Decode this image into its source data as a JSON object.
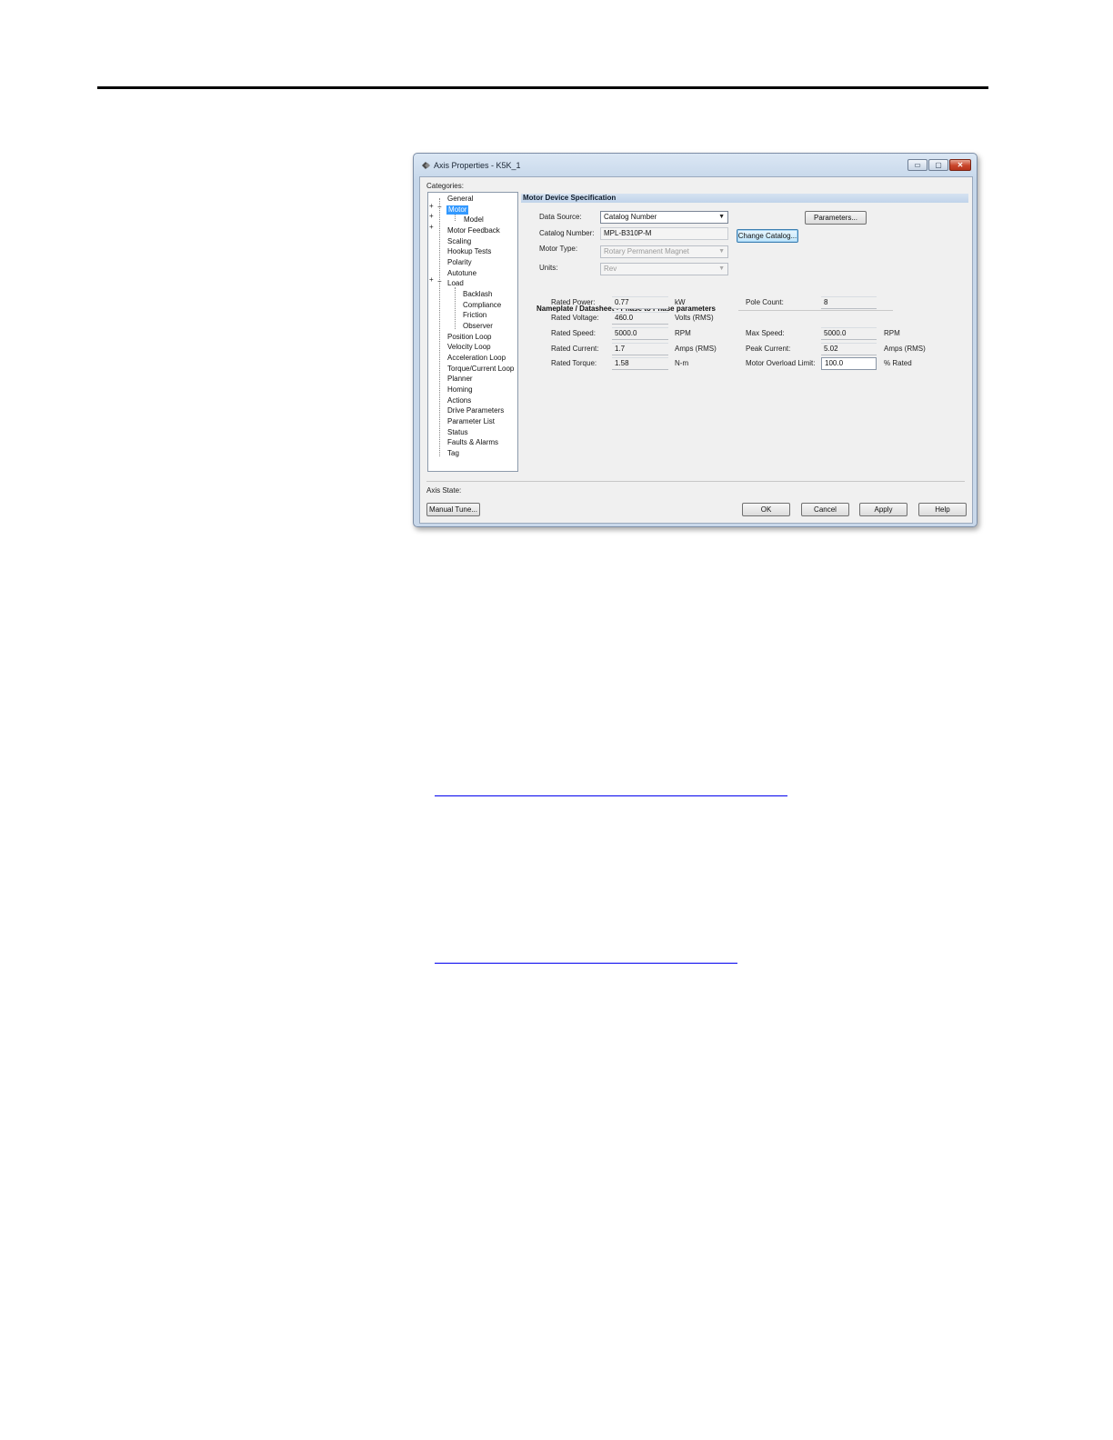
{
  "window": {
    "title": "Axis Properties - K5K_1",
    "min_glyph": "▭",
    "max_glyph": "▢",
    "close_glyph": "✕"
  },
  "categories_label": "Categories:",
  "tree": {
    "items": [
      "General",
      "Motor",
      "Model",
      "Motor Feedback",
      "Scaling",
      "Hookup Tests",
      "Polarity",
      "Autotune",
      "Load",
      "Backlash",
      "Compliance",
      "Friction",
      "Observer",
      "Position Loop",
      "Velocity Loop",
      "Acceleration Loop",
      "Torque/Current Loop",
      "Planner",
      "Homing",
      "Actions",
      "Drive Parameters",
      "Parameter List",
      "Status",
      "Faults & Alarms",
      "Tag"
    ],
    "expander_plus": "+",
    "expander_minus": "−"
  },
  "panel": {
    "header": "Motor Device Specification",
    "data_source_label": "Data Source:",
    "data_source_value": "Catalog Number",
    "parameters_button": "Parameters...",
    "catalog_number_label": "Catalog Number:",
    "catalog_number_value": "MPL-B310P-M",
    "change_catalog_button": "Change Catalog...",
    "motor_type_label": "Motor Type:",
    "motor_type_value": "Rotary Permanent Magnet",
    "units_label": "Units:",
    "units_value": "Rev",
    "dropdown_arrow": "▼"
  },
  "nameplate": {
    "title": "Nameplate / Datasheet - Phase to Phase parameters",
    "rated_power_label": "Rated Power:",
    "rated_power_value": "0.77",
    "rated_power_unit": "kW",
    "rated_voltage_label": "Rated Voltage:",
    "rated_voltage_value": "460.0",
    "rated_voltage_unit": "Volts (RMS)",
    "rated_speed_label": "Rated Speed:",
    "rated_speed_value": "5000.0",
    "rated_speed_unit": "RPM",
    "rated_current_label": "Rated Current:",
    "rated_current_value": "1.7",
    "rated_current_unit": "Amps (RMS)",
    "rated_torque_label": "Rated Torque:",
    "rated_torque_value": "1.58",
    "rated_torque_unit": "N-m",
    "pole_count_label": "Pole Count:",
    "pole_count_value": "8",
    "max_speed_label": "Max Speed:",
    "max_speed_value": "5000.0",
    "max_speed_unit": "RPM",
    "peak_current_label": "Peak Current:",
    "peak_current_value": "5.02",
    "peak_current_unit": "Amps (RMS)",
    "overload_label": "Motor Overload Limit:",
    "overload_value": "100.0",
    "overload_unit": "% Rated"
  },
  "footer": {
    "axis_state_label": "Axis State:",
    "manual_tune": "Manual Tune...",
    "ok": "OK",
    "cancel": "Cancel",
    "apply": "Apply",
    "help": "Help"
  },
  "colors": {
    "selection": "#3399ff",
    "link": "#0000ee"
  }
}
